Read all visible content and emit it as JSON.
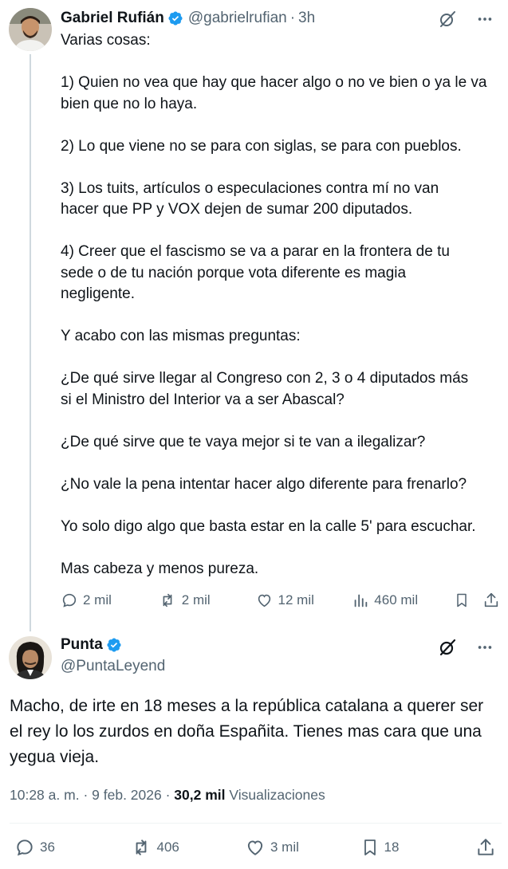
{
  "reply_tweet": {
    "name": "Gabriel Rufián",
    "handle": "@gabrielrufian",
    "separator": "·",
    "time": "3h",
    "body_lines": [
      "Varias cosas:",
      "",
      "1) Quien no vea que hay que hacer algo o no ve bien o ya le va",
      "bien que no lo haya.",
      "",
      "2) Lo que viene no se para con siglas, se para con pueblos.",
      "",
      "3) Los tuits, artículos o especulaciones contra mí no van",
      "hacer que PP y VOX dejen de sumar 200 diputados.",
      "",
      "4) Creer que el fascismo se va a parar en la frontera de tu",
      "sede o de tu nación porque vota diferente es magia",
      "negligente.",
      "",
      "Y acabo con las mismas preguntas:",
      "",
      "¿De qué sirve llegar al Congreso con 2, 3 o 4 diputados más",
      "si el Ministro del Interior va a ser Abascal?",
      "",
      "¿De qué sirve que te vaya mejor si te van a ilegalizar?",
      "",
      "¿No vale la pena intentar hacer algo diferente para frenarlo?",
      "",
      "Yo solo digo algo que basta estar en la calle 5' para escuchar.",
      "",
      "Mas cabeza y menos pureza."
    ],
    "stats": {
      "replies": "2 mil",
      "reposts": "2 mil",
      "likes": "12 mil",
      "views": "460 mil"
    }
  },
  "main_tweet": {
    "name": "Punta",
    "handle": "@PuntaLeyend",
    "text": "Macho, de irte en 18 meses a la república catalana a querer ser el rey lo los zurdos en doña Españita. Tienes mas cara que una yegua vieja.",
    "time": "10:28 a. m.",
    "dot": "·",
    "date": "9 feb. 2026",
    "views_count": "30,2 mil",
    "views_label": "Visualizaciones",
    "stats": {
      "replies": "36",
      "reposts": "406",
      "likes": "3 mil",
      "bookmarks": "18"
    }
  },
  "colors": {
    "verified": "#1d9bf0",
    "muted": "#536471",
    "text": "#0f1419",
    "thread_line": "#cfd9de"
  },
  "icons": [
    "grok-icon",
    "more-icon",
    "reply-icon",
    "repost-icon",
    "like-icon",
    "views-icon",
    "bookmark-icon",
    "share-icon",
    "verified-badge-icon"
  ]
}
